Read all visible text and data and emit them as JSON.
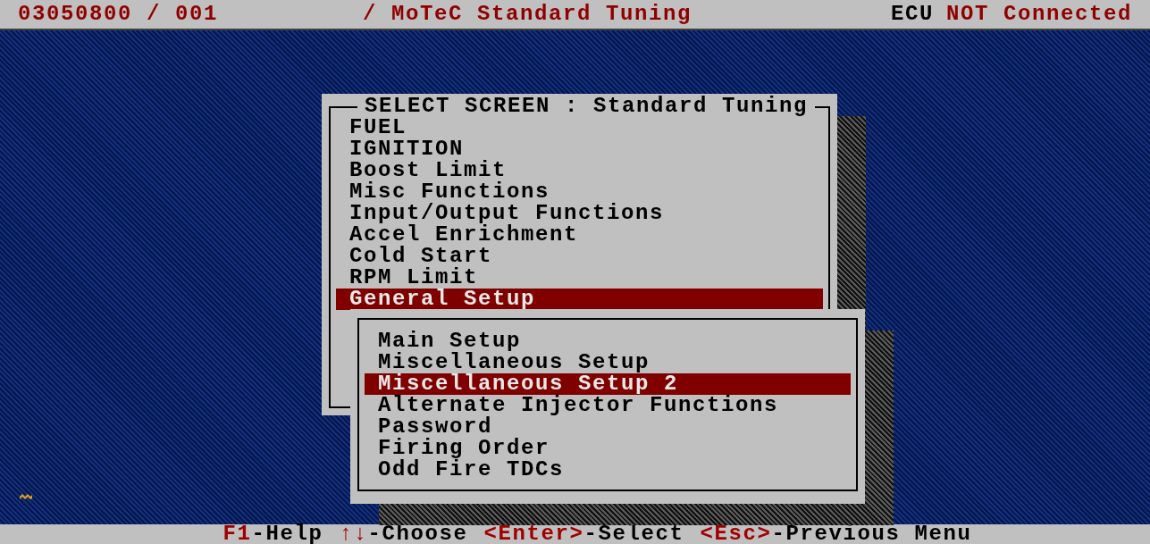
{
  "top_bar": {
    "file": "03050800 / 001",
    "title": "/ MoTeC Standard Tuning",
    "ecu_label": "ECU",
    "ecu_status": "NOT Connected"
  },
  "main_menu": {
    "title": "SELECT SCREEN : Standard Tuning",
    "items": [
      {
        "label": "FUEL",
        "selected": false
      },
      {
        "label": "IGNITION",
        "selected": false
      },
      {
        "label": "Boost Limit",
        "selected": false
      },
      {
        "label": "Misc Functions",
        "selected": false
      },
      {
        "label": "Input/Output Functions",
        "selected": false
      },
      {
        "label": "Accel Enrichment",
        "selected": false
      },
      {
        "label": "Cold Start",
        "selected": false
      },
      {
        "label": "RPM Limit",
        "selected": false
      },
      {
        "label": "General Setup",
        "selected": true
      }
    ]
  },
  "sub_menu": {
    "items": [
      {
        "label": "Main Setup",
        "selected": false
      },
      {
        "label": "Miscellaneous Setup",
        "selected": false
      },
      {
        "label": "Miscellaneous Setup 2",
        "selected": true
      },
      {
        "label": "Alternate Injector Functions",
        "selected": false
      },
      {
        "label": "Password",
        "selected": false
      },
      {
        "label": "Firing Order",
        "selected": false
      },
      {
        "label": "Odd Fire TDCs",
        "selected": false
      }
    ]
  },
  "status_bar": [
    {
      "key": "F1",
      "label": "-Help"
    },
    {
      "key": "↑↓",
      "label": "-Choose"
    },
    {
      "key": "<Enter>",
      "label": "-Select"
    },
    {
      "key": "<Esc>",
      "label": "-Previous Menu"
    }
  ]
}
